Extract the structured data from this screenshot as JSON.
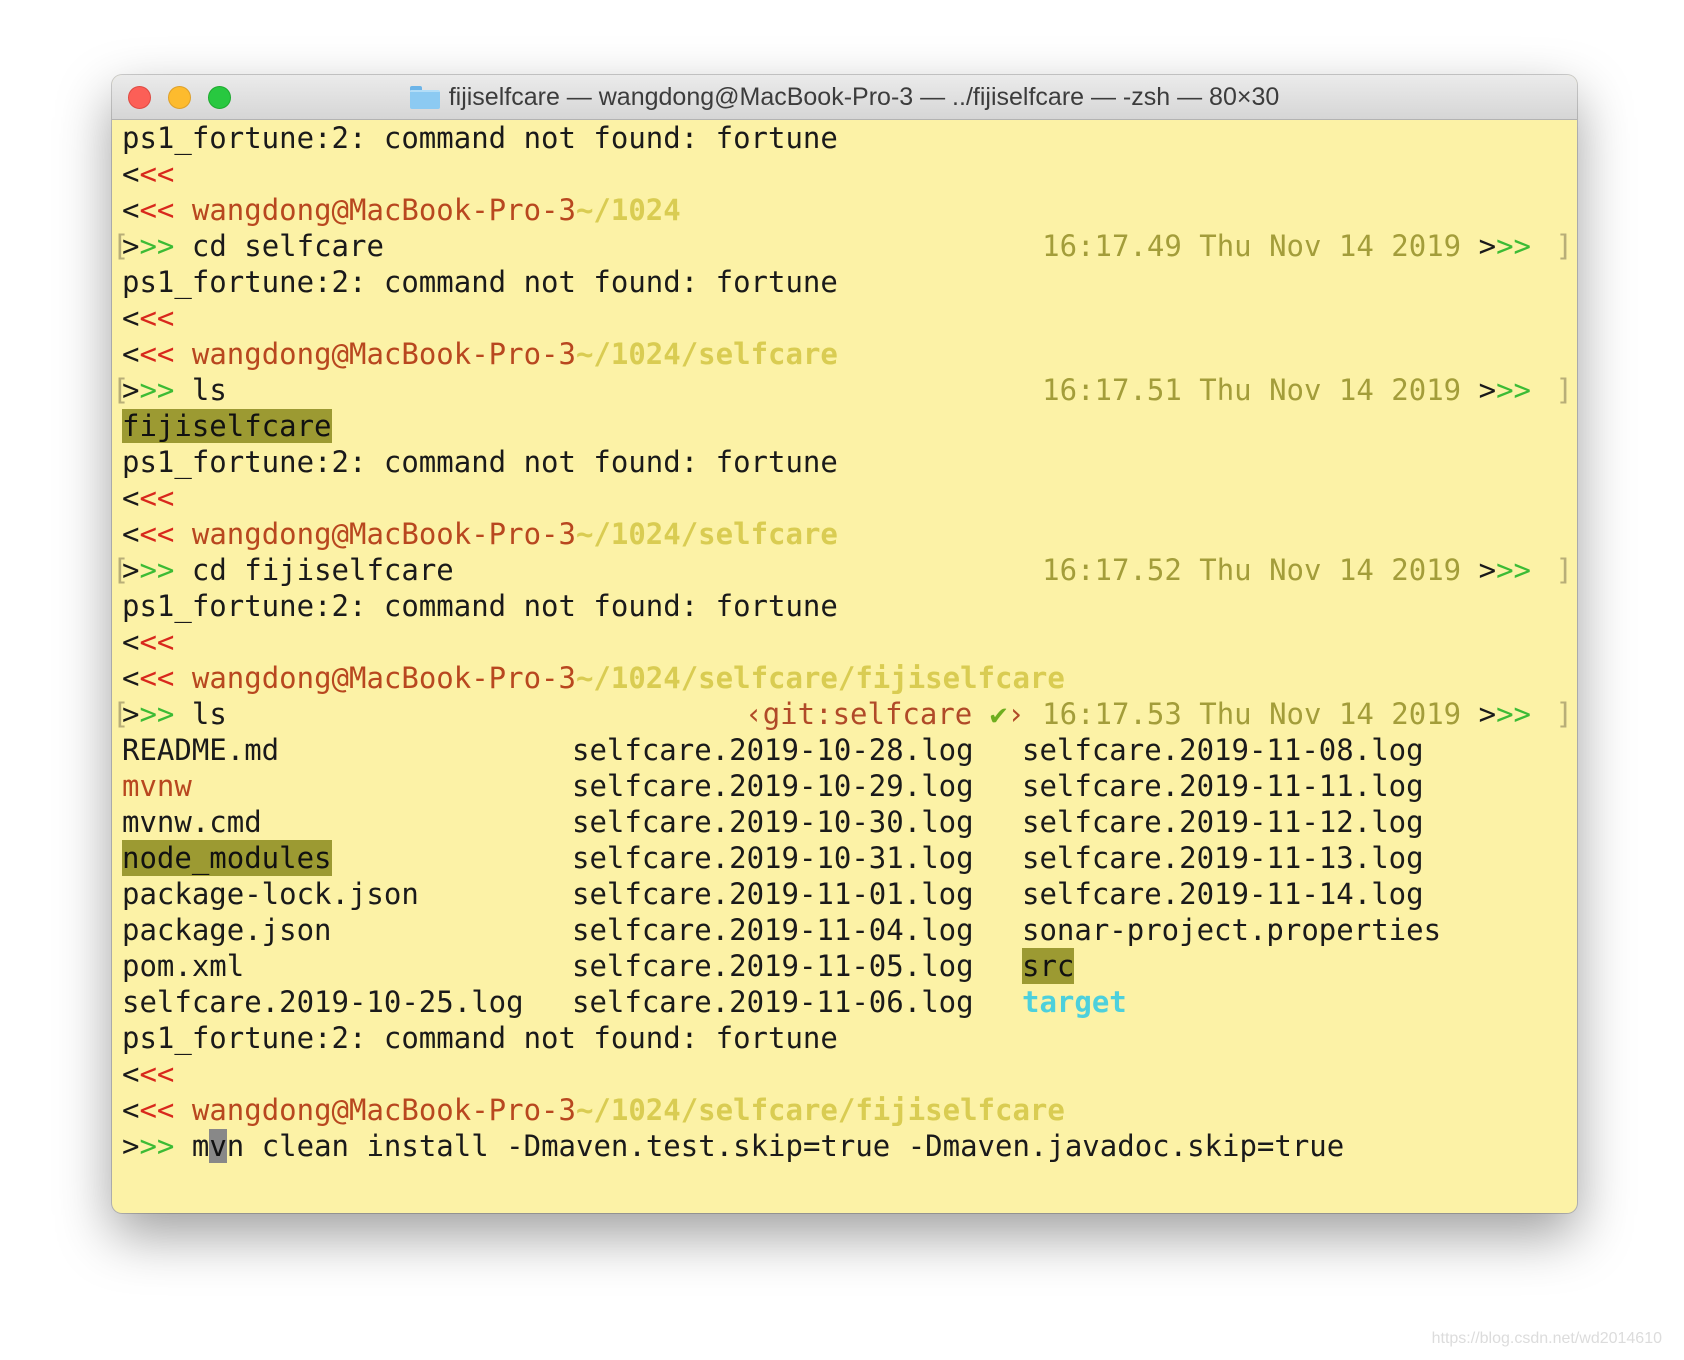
{
  "window": {
    "title": "fijiselfcare — wangdong@MacBook-Pro-3 — ../fijiselfcare — -zsh — 80×30"
  },
  "colors": {
    "terminal_bg": "#fcf2a6",
    "prompt_red": "#d8281c",
    "prompt_green": "#3cbb35",
    "user_host": "#b8471f",
    "path": "#d9cc52",
    "dir_highlight": "#9c9a32",
    "cyan_link": "#4dd0dc"
  },
  "terminal": {
    "error_text": "ps1_fortune:2: command not found: fortune",
    "prompt_in": "<<",
    "prompt_in_first": "<",
    "prompt_out": ">>",
    "prompt_out_first": ">",
    "user_host": "wangdong@MacBook-Pro-3",
    "bracket_left": "[",
    "bracket_right": "]",
    "blocks": [
      {
        "path": "~/1024",
        "command": "cd selfcare",
        "time": "16:17.49 Thu Nov 14 2019"
      },
      {
        "path": "~/1024/selfcare",
        "command": "ls",
        "time": "16:17.51 Thu Nov 14 2019",
        "output": "fijiselfcare"
      },
      {
        "path": "~/1024/selfcare",
        "command": "cd fijiselfcare",
        "time": "16:17.52 Thu Nov 14 2019"
      },
      {
        "path": "~/1024/selfcare/fijiselfcare",
        "command": "ls",
        "git": "‹git:selfcare ",
        "git_check": "✔",
        "git_close": "›",
        "time": "16:17.53 Thu Nov 14 2019"
      },
      {
        "path": "~/1024/selfcare/fijiselfcare"
      }
    ],
    "ls_rows": [
      [
        "README.md",
        "selfcare.2019-10-28.log",
        "selfcare.2019-11-08.log"
      ],
      [
        "mvnw",
        "selfcare.2019-10-29.log",
        "selfcare.2019-11-11.log"
      ],
      [
        "mvnw.cmd",
        "selfcare.2019-10-30.log",
        "selfcare.2019-11-12.log"
      ],
      [
        "node_modules",
        "selfcare.2019-10-31.log",
        "selfcare.2019-11-13.log"
      ],
      [
        "package-lock.json",
        "selfcare.2019-11-01.log",
        "selfcare.2019-11-14.log"
      ],
      [
        "package.json",
        "selfcare.2019-11-04.log",
        "sonar-project.properties"
      ],
      [
        "pom.xml",
        "selfcare.2019-11-05.log",
        "src"
      ],
      [
        "selfcare.2019-10-25.log",
        "selfcare.2019-11-06.log",
        "target"
      ]
    ],
    "current_command_before_cursor": "m",
    "current_command_cursor_char": "v",
    "current_command_after_cursor": "n clean install -Dmaven.test.skip=true -Dmaven.javadoc.skip=true"
  },
  "watermark": "https://blog.csdn.net/wd2014610"
}
